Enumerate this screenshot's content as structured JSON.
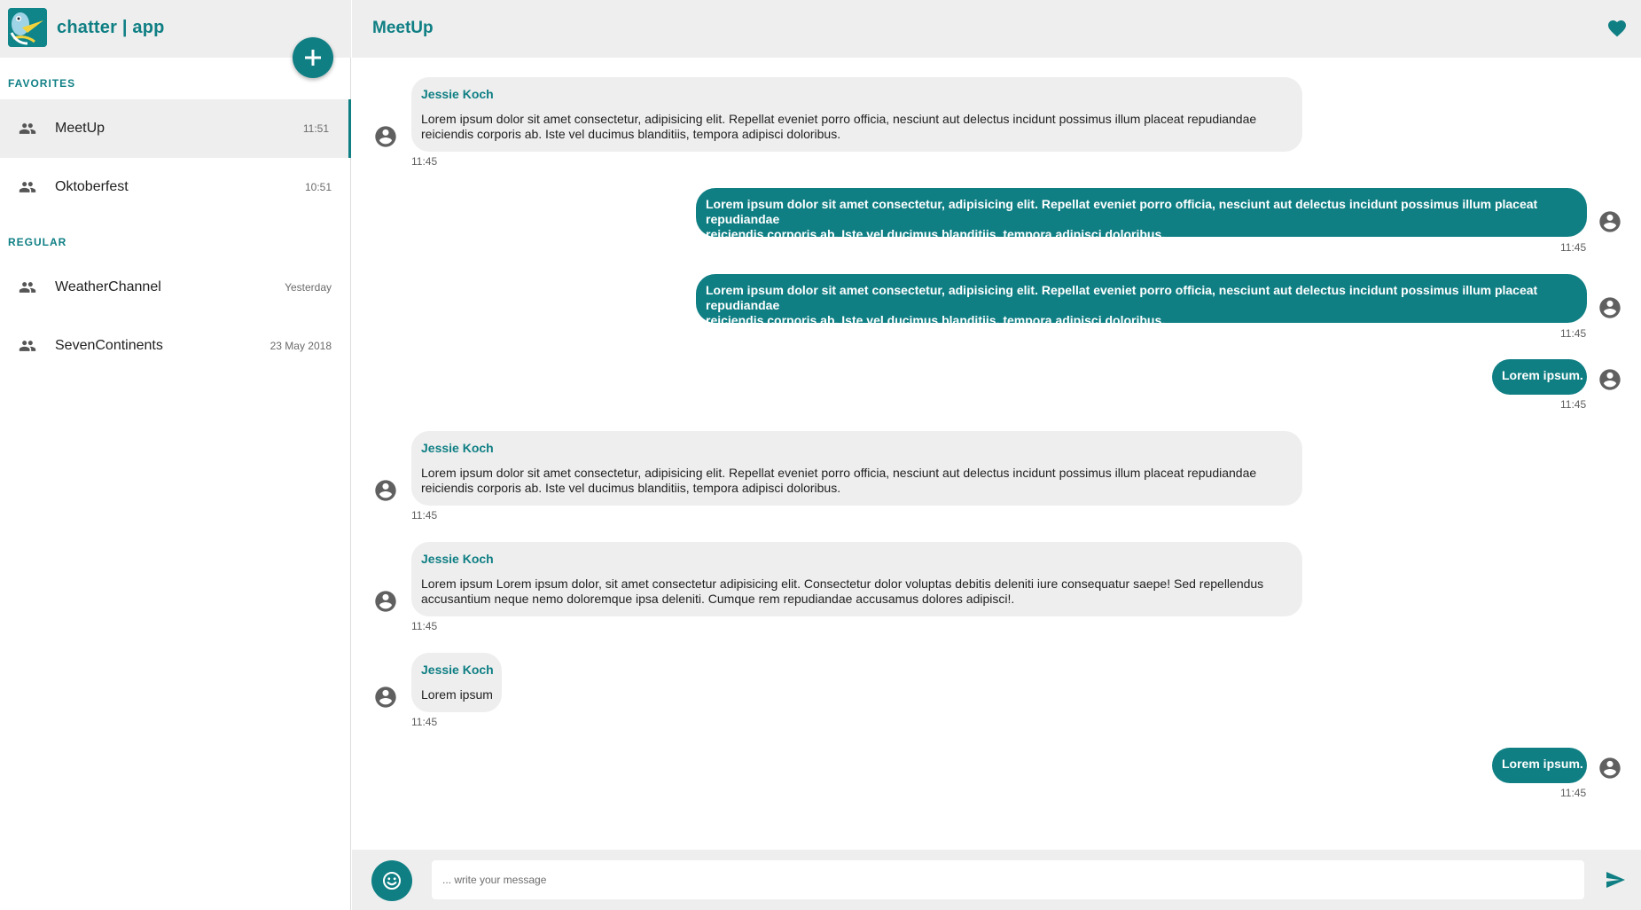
{
  "app": {
    "name": "chatter | app"
  },
  "sidebar": {
    "favorites_label": "FAVORITES",
    "regular_label": "REGULAR",
    "favorites": [
      {
        "name": "MeetUp",
        "time": "11:51",
        "icon": "group-icon",
        "active": true
      },
      {
        "name": "Oktoberfest",
        "time": "10:51",
        "icon": "group-icon",
        "active": false
      }
    ],
    "regular": [
      {
        "name": "WeatherChannel",
        "time": "Yesterday",
        "icon": "group-icon"
      },
      {
        "name": "SevenContinents",
        "time": "23 May 2018",
        "icon": "group-icon"
      }
    ]
  },
  "chat": {
    "title": "MeetUp",
    "messages": [
      {
        "direction": "incoming",
        "sender": "Jessie Koch",
        "line1": "Lorem ipsum dolor sit amet consectetur, adipisicing elit. Repellat eveniet porro officia, nesciunt aut delectus incidunt possimus illum placeat repudiandae",
        "line2": "reiciendis corporis ab. Iste vel ducimus blanditiis, tempora adipisci doloribus.",
        "time": "11:45"
      },
      {
        "direction": "outgoing",
        "line1": "Lorem ipsum dolor sit amet consectetur, adipisicing elit. Repellat eveniet porro officia, nesciunt aut delectus incidunt possimus illum placeat repudiandae",
        "line2": "reiciendis corporis ab. Iste vel ducimus blanditiis, tempora adipisci doloribus.",
        "time": "11:45"
      },
      {
        "direction": "outgoing",
        "line1": "Lorem ipsum dolor sit amet consectetur, adipisicing elit. Repellat eveniet porro officia, nesciunt aut delectus incidunt possimus illum placeat repudiandae",
        "line2": "reiciendis corporis ab. Iste vel ducimus blanditiis, tempora adipisci doloribus.",
        "time": "11:45"
      },
      {
        "direction": "outgoing",
        "line1": "Lorem ipsum.",
        "time": "11:45"
      },
      {
        "direction": "incoming",
        "sender": "Jessie Koch",
        "line1": "Lorem ipsum dolor sit amet consectetur, adipisicing elit. Repellat eveniet porro officia, nesciunt aut delectus incidunt possimus illum placeat repudiandae",
        "line2": "reiciendis corporis ab. Iste vel ducimus blanditiis, tempora adipisci doloribus.",
        "time": "11:45"
      },
      {
        "direction": "incoming",
        "sender": "Jessie Koch",
        "line1": "Lorem ipsum Lorem ipsum dolor, sit amet consectetur adipisicing elit. Consectetur dolor voluptas debitis deleniti iure consequatur saepe! Sed repellendus",
        "line2": "accusantium neque nemo doloremque ipsa deleniti. Cumque rem repudiandae accusamus dolores adipisci!.",
        "time": "11:45"
      },
      {
        "direction": "incoming",
        "sender": "Jessie Koch",
        "line1": "Lorem ipsum",
        "time": "11:45"
      },
      {
        "direction": "outgoing",
        "line1": "Lorem ipsum.",
        "time": "11:45"
      }
    ]
  },
  "composer": {
    "placeholder": "... write your message",
    "emoji_icon": "emoji-smile-icon",
    "send_icon": "send-icon"
  },
  "header": {
    "favorite_icon": "heart-icon"
  },
  "colors": {
    "accent": "#0f7f84",
    "header_bg": "#eeeeee",
    "bubble_in": "#eeeeee",
    "bubble_out": "#0f7f84"
  }
}
